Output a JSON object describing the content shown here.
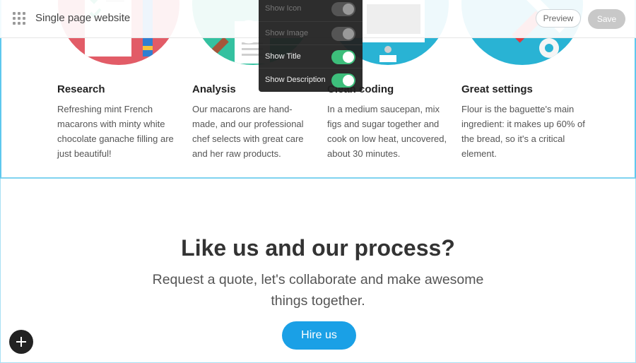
{
  "topbar": {
    "site_title": "Single page website",
    "preview_label": "Preview",
    "save_label": "Save",
    "menu_icon": "grid-icon"
  },
  "panel": {
    "items": [
      {
        "label": "Show Icon",
        "on": false
      },
      {
        "label": "Show Image",
        "on": true
      },
      {
        "label": "Show Title",
        "on": true
      },
      {
        "label": "Show Description",
        "on": true
      }
    ]
  },
  "features": [
    {
      "title": "Research",
      "text": "Refreshing mint French macarons with minty white chocolate ganache filling are just beautiful!",
      "color": "#e25c67"
    },
    {
      "title": "Analysis",
      "text": "Our macarons are hand-made, and our professional chef selects with great care and her raw products.",
      "color": "#34c1a0"
    },
    {
      "title": "Clean coding",
      "text": "In a medium saucepan, mix figs and sugar together and cook on low heat, uncovered, about 30 minutes.",
      "color": "#29b3d4"
    },
    {
      "title": "Great settings",
      "text": "Flour is the baguette's main ingredient: it makes up 60% of the bread, so it's a critical element.",
      "color": "#29b3d4"
    }
  ],
  "cta": {
    "heading": "Like us and our process?",
    "subheading": "Request a quote, let's collaborate and make awesome things together.",
    "button_label": "Hire us"
  },
  "colors": {
    "accent": "#1aa0e6",
    "toggle_on": "#3dbe7b",
    "selection_border": "#5ec8ee"
  }
}
